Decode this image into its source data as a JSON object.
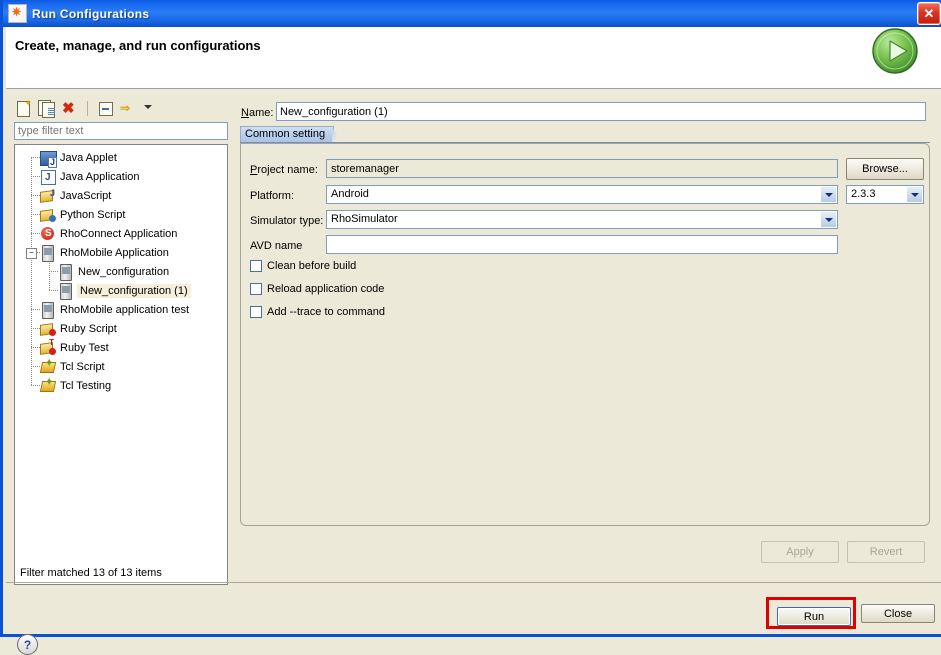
{
  "window": {
    "title": "Run Configurations",
    "app_icon": "run-configurations-icon",
    "close_label": "✕"
  },
  "header": {
    "title": "Create, manage, and run configurations",
    "icon": "green-play-circle-icon"
  },
  "tree_toolbar": {
    "buttons": [
      {
        "name": "new-launch-configuration-button",
        "icon": "new-document-icon",
        "tooltip": "New launch configuration"
      },
      {
        "name": "duplicate-configuration-button",
        "icon": "duplicate-document-icon",
        "tooltip": "Duplicate"
      },
      {
        "name": "delete-configuration-button",
        "icon": "delete-red-x-icon",
        "tooltip": "Delete"
      },
      {
        "name": "collapse-all-button",
        "icon": "collapse-all-icon",
        "tooltip": "Collapse All"
      },
      {
        "name": "filter-menu-button",
        "icon": "filter-arrows-icon",
        "tooltip": "Filter"
      }
    ]
  },
  "filter": {
    "placeholder": "type filter text",
    "value": "",
    "status": "Filter matched 13 of 13 items"
  },
  "tree": {
    "items": [
      {
        "label": "Java Applet",
        "icon": "java-applet-icon",
        "depth": 1,
        "selected": false,
        "expander": ""
      },
      {
        "label": "Java Application",
        "icon": "java-application-icon",
        "depth": 1,
        "selected": false,
        "expander": ""
      },
      {
        "label": "JavaScript",
        "icon": "javascript-icon",
        "depth": 1,
        "selected": false,
        "expander": ""
      },
      {
        "label": "Python Script",
        "icon": "python-script-icon",
        "depth": 1,
        "selected": false,
        "expander": ""
      },
      {
        "label": "RhoConnect Application",
        "icon": "rhoconnect-icon",
        "depth": 1,
        "selected": false,
        "expander": ""
      },
      {
        "label": "RhoMobile Application",
        "icon": "rhomobile-icon",
        "depth": 1,
        "selected": false,
        "expander": "−"
      },
      {
        "label": "New_configuration",
        "icon": "rhomobile-icon",
        "depth": 2,
        "selected": false,
        "expander": ""
      },
      {
        "label": "New_configuration (1)",
        "icon": "rhomobile-icon",
        "depth": 2,
        "selected": true,
        "expander": ""
      },
      {
        "label": "RhoMobile application test",
        "icon": "rhomobile-icon",
        "depth": 1,
        "selected": false,
        "expander": ""
      },
      {
        "label": "Ruby Script",
        "icon": "ruby-script-icon",
        "depth": 1,
        "selected": false,
        "expander": ""
      },
      {
        "label": "Ruby Test",
        "icon": "ruby-test-icon",
        "depth": 1,
        "selected": false,
        "expander": ""
      },
      {
        "label": "Tcl Script",
        "icon": "tcl-script-icon",
        "depth": 1,
        "selected": false,
        "expander": ""
      },
      {
        "label": "Tcl Testing",
        "icon": "tcl-testing-icon",
        "depth": 1,
        "selected": false,
        "expander": ""
      }
    ]
  },
  "help": {
    "icon": "help-question-icon",
    "label": "?"
  },
  "form": {
    "name_label": "Name:",
    "name_value": "New_configuration (1)",
    "tab_label": "Common setting",
    "project_label": "Project name:",
    "project_value": "storemanager",
    "browse_label": "Browse...",
    "platform_label": "Platform:",
    "platform_value": "Android",
    "version_value": "2.3.3",
    "simulator_label": "Simulator type:",
    "simulator_value": "RhoSimulator",
    "avd_label": "AVD name",
    "avd_value": "",
    "checkboxes": [
      {
        "label": "Clean before build",
        "checked": false
      },
      {
        "label": "Reload application code",
        "checked": false
      },
      {
        "label": "Add --trace to command",
        "checked": false
      }
    ]
  },
  "buttons": {
    "apply": "Apply",
    "apply_enabled": false,
    "revert": "Revert",
    "revert_enabled": false,
    "run": "Run",
    "close": "Close"
  },
  "colors": {
    "titlebar_blue": "#1464ec",
    "window_border": "#0a52d6",
    "dialog_bg": "#ece9d8",
    "tab_blue": "#b6cdec",
    "selection": "#f5f0dc",
    "highlight_rect": "#e00000",
    "play_green": "#6cbf3f"
  }
}
